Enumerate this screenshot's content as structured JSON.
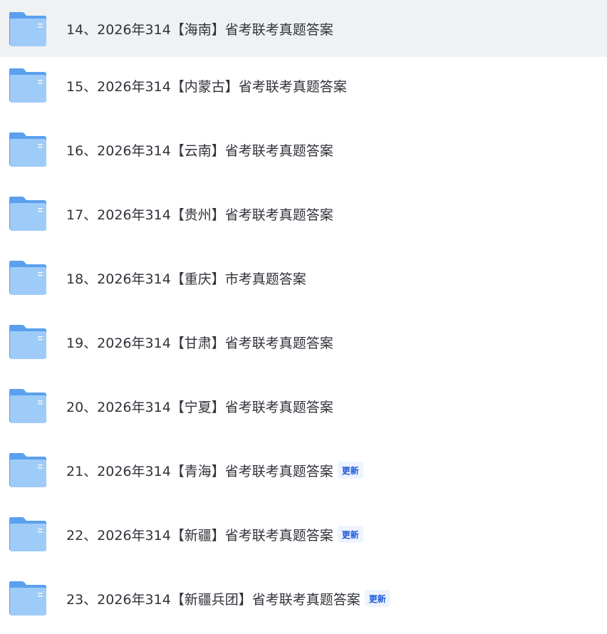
{
  "colors": {
    "selected_row_bg": "#f0f1f3",
    "folder_back": "#5aa0ee",
    "folder_front": "#9fcbf8",
    "badge_bg": "#eef4fe",
    "badge_text": "#1d5ad8",
    "text": "#30333a"
  },
  "files": [
    {
      "name": "14、2026年314【海南】省考联考真题答案",
      "icon": "folder-icon",
      "badge": ""
    },
    {
      "name": "15、2026年314【内蒙古】省考联考真题答案",
      "icon": "folder-icon",
      "badge": ""
    },
    {
      "name": "16、2026年314【云南】省考联考真题答案",
      "icon": "folder-icon",
      "badge": ""
    },
    {
      "name": "17、2026年314【贵州】省考联考真题答案",
      "icon": "folder-icon",
      "badge": ""
    },
    {
      "name": "18、2026年314【重庆】市考真题答案",
      "icon": "folder-icon",
      "badge": ""
    },
    {
      "name": "19、2026年314【甘肃】省考联考真题答案",
      "icon": "folder-icon",
      "badge": ""
    },
    {
      "name": "20、2026年314【宁夏】省考联考真题答案",
      "icon": "folder-icon",
      "badge": ""
    },
    {
      "name": "21、2026年314【青海】省考联考真题答案",
      "icon": "folder-icon",
      "badge": "更新"
    },
    {
      "name": "22、2026年314【新疆】省考联考真题答案",
      "icon": "folder-icon",
      "badge": "更新"
    },
    {
      "name": "23、2026年314【新疆兵团】省考联考真题答案",
      "icon": "folder-icon",
      "badge": "更新"
    }
  ]
}
